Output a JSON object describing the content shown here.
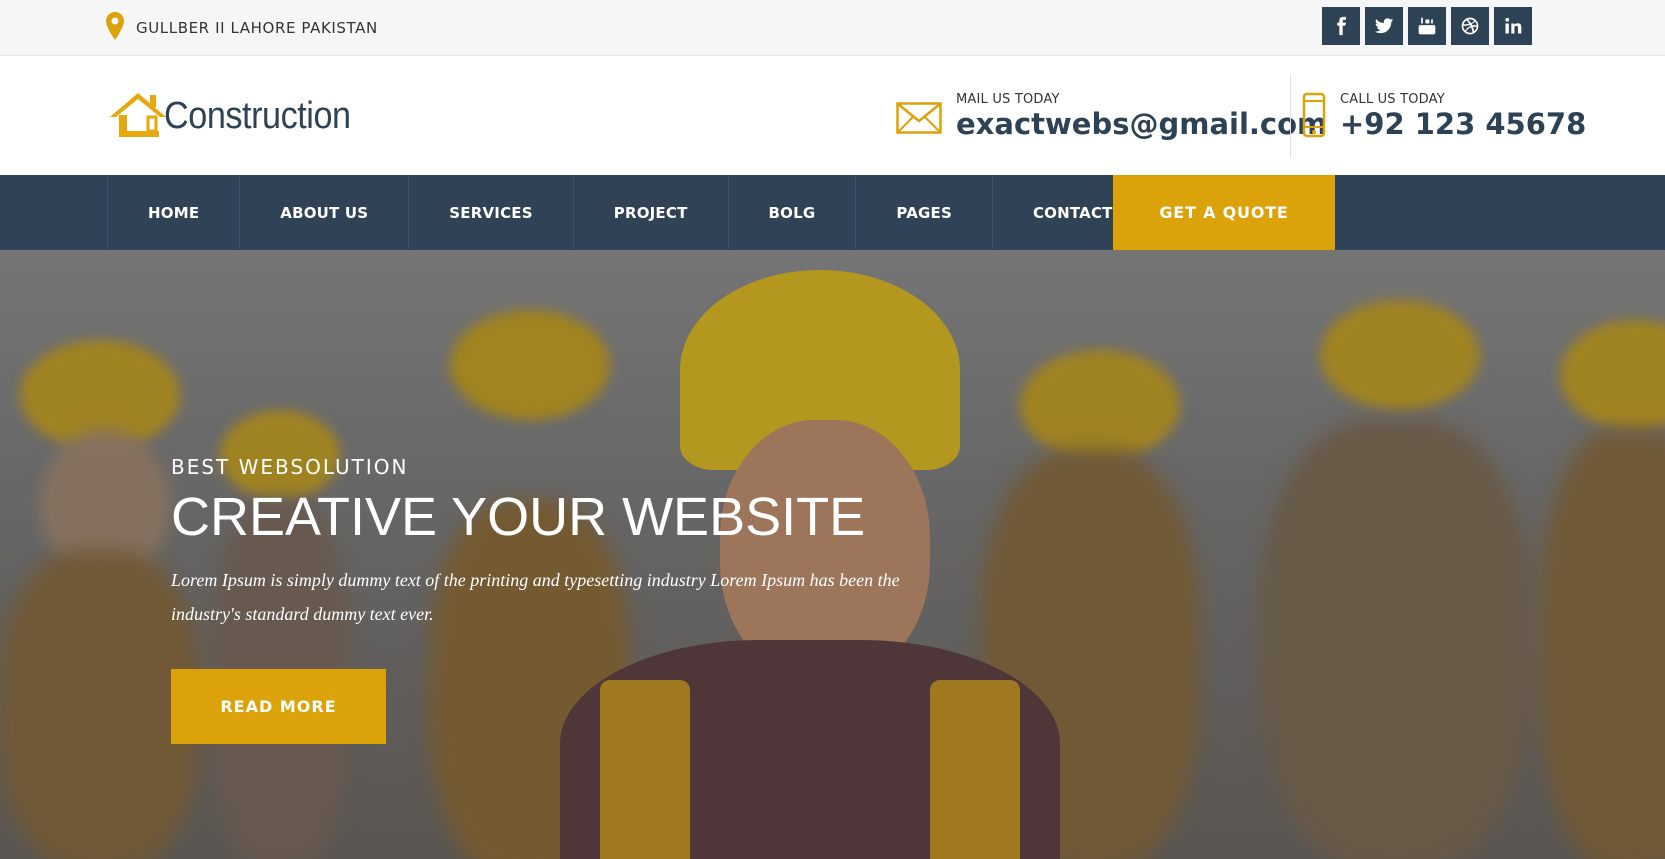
{
  "topbar": {
    "location": "GULLBER II LAHORE PAKISTAN",
    "social": [
      "facebook-icon",
      "twitter-icon",
      "youtube-icon",
      "dribbble-icon",
      "linkedin-icon"
    ]
  },
  "header": {
    "logo_text": "Construction",
    "mail": {
      "label": "MAIL US TODAY",
      "value": "exactwebs@gmail.com"
    },
    "phone": {
      "label": "CALL US TODAY",
      "value": "+92 123 45678"
    }
  },
  "nav": {
    "items": [
      "HOME",
      "ABOUT US",
      "SERVICES",
      "PROJECT",
      "BOLG",
      "PAGES",
      "CONTACT US"
    ],
    "quote": "GET A QUOTE"
  },
  "hero": {
    "kicker": "BEST WEBSOLUTION",
    "headline": "CREATIVE YOUR WEBSITE",
    "description": "Lorem Ipsum is simply dummy text of the printing and typesetting industry Lorem Ipsum has been the industry's standard dummy text ever.",
    "button": "READ MORE"
  },
  "colors": {
    "accent": "#dca20a",
    "navy": "#2f4256"
  }
}
